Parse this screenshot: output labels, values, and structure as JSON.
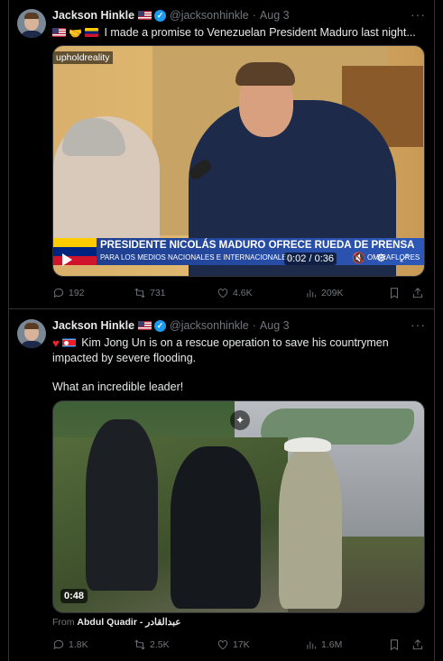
{
  "tweets": [
    {
      "author_name": "Jackson Hinkle",
      "handle": "@jacksonhinkle",
      "separator": "·",
      "date": "Aug 3",
      "more": "···",
      "text": "I made a promise to Venezuelan President Maduro last night...",
      "emoji_icons": [
        "us-flag-icon",
        "handshake-icon",
        "venezuela-flag-icon"
      ],
      "video": {
        "watermark": "upholdreality",
        "lower_third_title": "PRESIDENTE NICOLÁS MADURO OFRECE RUEDA DE PRENSA",
        "lower_third_subtitle": "PARA LOS MEDIOS NACIONALES E INTERNACIONALES",
        "lower_third_right": "OMIRAFLORES",
        "timestamp": "0:02 / 0:36"
      },
      "actions": {
        "replies": "192",
        "reposts": "731",
        "likes": "4.6K",
        "views": "209K"
      }
    },
    {
      "author_name": "Jackson Hinkle",
      "handle": "@jacksonhinkle",
      "separator": "·",
      "date": "Aug 3",
      "more": "···",
      "text_line1": "Kim Jong Un is on a rescue operation to save his countrymen",
      "text_line2": "impacted by severe flooding.",
      "text_line3": "What an incredible leader!",
      "emoji_icons": [
        "red-heart-icon",
        "north-korea-flag-icon"
      ],
      "video": {
        "duration": "0:48"
      },
      "from_label": "From",
      "from_name": "Abdul Quadir - عبدالقادر",
      "actions": {
        "replies": "1.8K",
        "reposts": "2.5K",
        "likes": "17K",
        "views": "1.6M"
      }
    }
  ],
  "colors": {
    "background": "#000000",
    "text_primary": "#e7e9ea",
    "text_secondary": "#71767b",
    "verified": "#1d9bf0",
    "border": "#2f3336"
  }
}
